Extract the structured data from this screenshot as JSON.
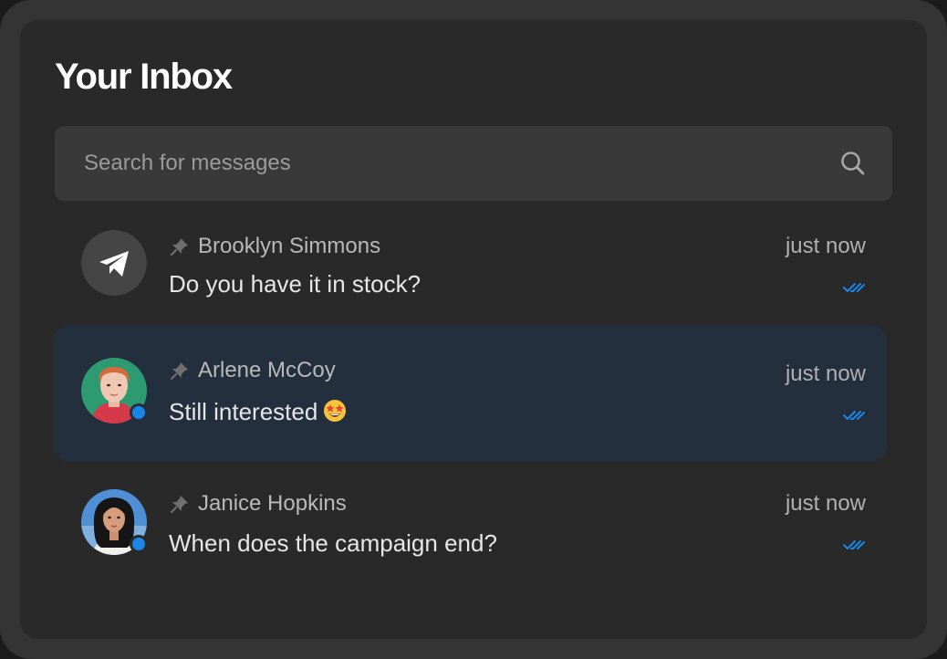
{
  "inbox": {
    "title": "Your Inbox",
    "search": {
      "placeholder": "Search for messages",
      "icon": "search-icon"
    },
    "conversations": [
      {
        "name": "Brooklyn Simmons",
        "message": "Do you have it in stock?",
        "time": "just now",
        "avatar": "telegram-icon",
        "pinned": true,
        "online": false,
        "read_status": "double-check-icon"
      },
      {
        "name": "Arlene McCoy",
        "message": "Still interested",
        "emoji": "star-struck-emoji",
        "time": "just now",
        "avatar": "avatar-photo",
        "pinned": true,
        "online": true,
        "selected": true,
        "read_status": "double-check-icon"
      },
      {
        "name": "Janice Hopkins",
        "message": "When does the campaign end?",
        "time": "just now",
        "avatar": "avatar-photo",
        "pinned": true,
        "online": true,
        "read_status": "double-check-icon"
      }
    ]
  },
  "colors": {
    "background": "#292929",
    "frame": "#343434",
    "search_bg": "#393939",
    "selected_row": "#232f3d",
    "accent": "#1a86e8"
  }
}
